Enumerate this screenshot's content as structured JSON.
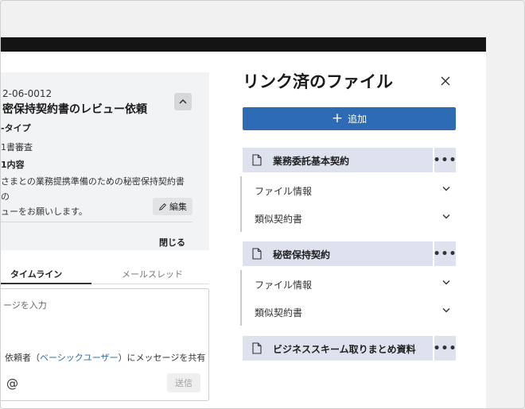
{
  "request": {
    "id": "2-06-0012",
    "title": "密保持契約書のレビュー依頼",
    "type_label": "-タイプ",
    "type_value": "1書審査",
    "content_label": "1内容",
    "description_line1": "さまとの業務提携準備のための秘密保持契約書の",
    "description_line2": "ューをお願いします。",
    "edit_label": "編集",
    "close_label": "閉じる"
  },
  "tabs": [
    {
      "label": "タイムライン",
      "active": true
    },
    {
      "label": "メールスレッド",
      "active": false
    }
  ],
  "message": {
    "placeholder": "ージを入力",
    "share_prefix": "依頼者（",
    "share_user": "ベーシックユーザー",
    "share_suffix": "）にメッセージを共有",
    "at_symbol": "@",
    "send_label": "送信"
  },
  "panel": {
    "title": "リンク済のファイル",
    "add_label": "追加",
    "files": [
      {
        "name": "業務委託基本契約",
        "more": "•••",
        "subs": [
          "ファイル情報",
          "類似契約書"
        ]
      },
      {
        "name": "秘密保持契約",
        "more": "•••",
        "subs": [
          "ファイル情報",
          "類似契約書"
        ]
      },
      {
        "name": "ビジネススキーム取りまとめ資料",
        "more": "•••",
        "subs": []
      }
    ]
  },
  "colors": {
    "accent": "#2e6bb5",
    "file_header_bg": "#dde2ee",
    "topbar": "#141414",
    "link": "#2b6cb0"
  }
}
